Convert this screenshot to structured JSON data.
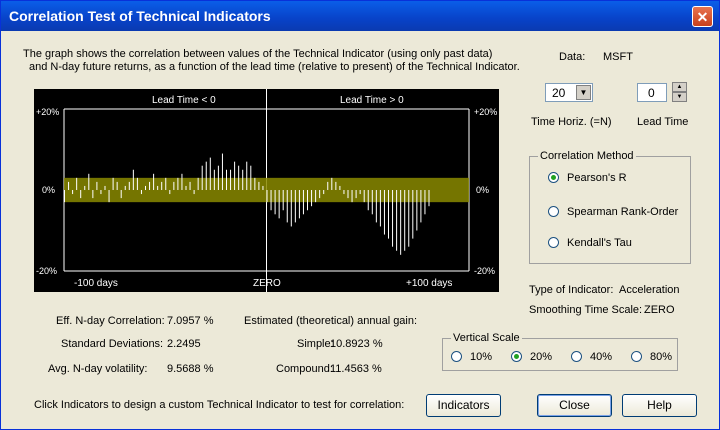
{
  "window": {
    "title": "Correlation Test of Technical Indicators"
  },
  "description": {
    "line1": "The graph shows the correlation between values of the Technical Indicator (using only past data)",
    "line2": "and N-day future returns, as a function of the lead time (relative to present) of the Technical Indicator."
  },
  "chart": {
    "label_left": "Lead Time < 0",
    "label_right": "Lead Time > 0",
    "y_top": "+20%",
    "y_mid": "0%",
    "y_bottom": "-20%",
    "x_left": "-100 days",
    "x_mid": "ZERO",
    "x_right": "+100 days",
    "colors": {
      "bars": "#ffffff",
      "band": "#8a8a00",
      "axis": "#ffffff",
      "background": "#000000"
    }
  },
  "chart_data": {
    "type": "bar",
    "xlabel": "",
    "ylabel": "",
    "x_range": [
      -100,
      100
    ],
    "ylim": [
      -20,
      20
    ],
    "band": [
      -3,
      3
    ],
    "x": [
      -100,
      -98,
      -96,
      -94,
      -92,
      -90,
      -88,
      -86,
      -84,
      -82,
      -80,
      -78,
      -76,
      -74,
      -72,
      -70,
      -68,
      -66,
      -64,
      -62,
      -60,
      -58,
      -56,
      -54,
      -52,
      -50,
      -48,
      -46,
      -44,
      -42,
      -40,
      -38,
      -36,
      -34,
      -32,
      -30,
      -28,
      -26,
      -24,
      -22,
      -20,
      -18,
      -16,
      -14,
      -12,
      -10,
      -8,
      -6,
      -4,
      -2,
      0,
      2,
      4,
      6,
      8,
      10,
      12,
      14,
      16,
      18,
      20,
      22,
      24,
      26,
      28,
      30,
      32,
      34,
      36,
      38,
      40,
      42,
      44,
      46,
      48,
      50,
      52,
      54,
      56,
      58,
      60,
      62,
      64,
      66,
      68,
      70,
      72,
      74,
      76,
      78,
      80
    ],
    "values": [
      -3,
      2,
      -1,
      3,
      -2,
      1,
      4,
      -2,
      2,
      -1,
      1,
      -3,
      3,
      2,
      -2,
      1,
      2,
      5,
      3,
      -1,
      1,
      2,
      4,
      1,
      2,
      3,
      -1,
      2,
      3,
      4,
      1,
      2,
      -1,
      3,
      6,
      7,
      8,
      5,
      6,
      9,
      5,
      5,
      7,
      6,
      5,
      7,
      6,
      3,
      2,
      1,
      -3,
      -5,
      -6,
      -7,
      -5,
      -8,
      -9,
      -8,
      -7,
      -6,
      -5,
      -4,
      -3,
      -2,
      -1,
      2,
      3,
      2,
      1,
      -1,
      -2,
      -3,
      -2,
      -1,
      -3,
      -5,
      -6,
      -8,
      -9,
      -11,
      -12,
      -14,
      -15,
      -16,
      -15,
      -14,
      -12,
      -10,
      -8,
      -6,
      -4
    ]
  },
  "data_info": {
    "label": "Data:",
    "value": "MSFT"
  },
  "time_horiz": {
    "value": "20",
    "label": "Time Horiz. (=N)"
  },
  "lead_time": {
    "value": "0",
    "label": "Lead Time"
  },
  "correlation_method": {
    "legend": "Correlation Method",
    "options": [
      "Pearson's R",
      "Spearman Rank-Order",
      "Kendall's Tau"
    ],
    "selected": 0
  },
  "indicator": {
    "type_label": "Type of Indicator:",
    "type_value": "Acceleration",
    "smooth_label": "Smoothing Time Scale:",
    "smooth_value": "ZERO"
  },
  "stats": {
    "corr_label": "Eff. N-day Correlation:",
    "corr_value": "7.0957 %",
    "sd_label": "Standard Deviations:",
    "sd_value": "2.2495",
    "vol_label": "Avg. N-day volatility:",
    "vol_value": "9.5688 %",
    "gain_label": "Estimated (theoretical) annual gain:",
    "simple_label": "Simple:",
    "simple_value": "10.8923 %",
    "compound_label": "Compound:",
    "compound_value": "11.4563 %"
  },
  "vertical_scale": {
    "legend": "Vertical Scale",
    "options": [
      "10%",
      "20%",
      "40%",
      "80%"
    ],
    "selected": 1
  },
  "footer": {
    "hint": "Click Indicators to design a custom Technical Indicator to test for correlation:",
    "indicators_btn": "Indicators",
    "close_btn": "Close",
    "help_btn": "Help"
  }
}
